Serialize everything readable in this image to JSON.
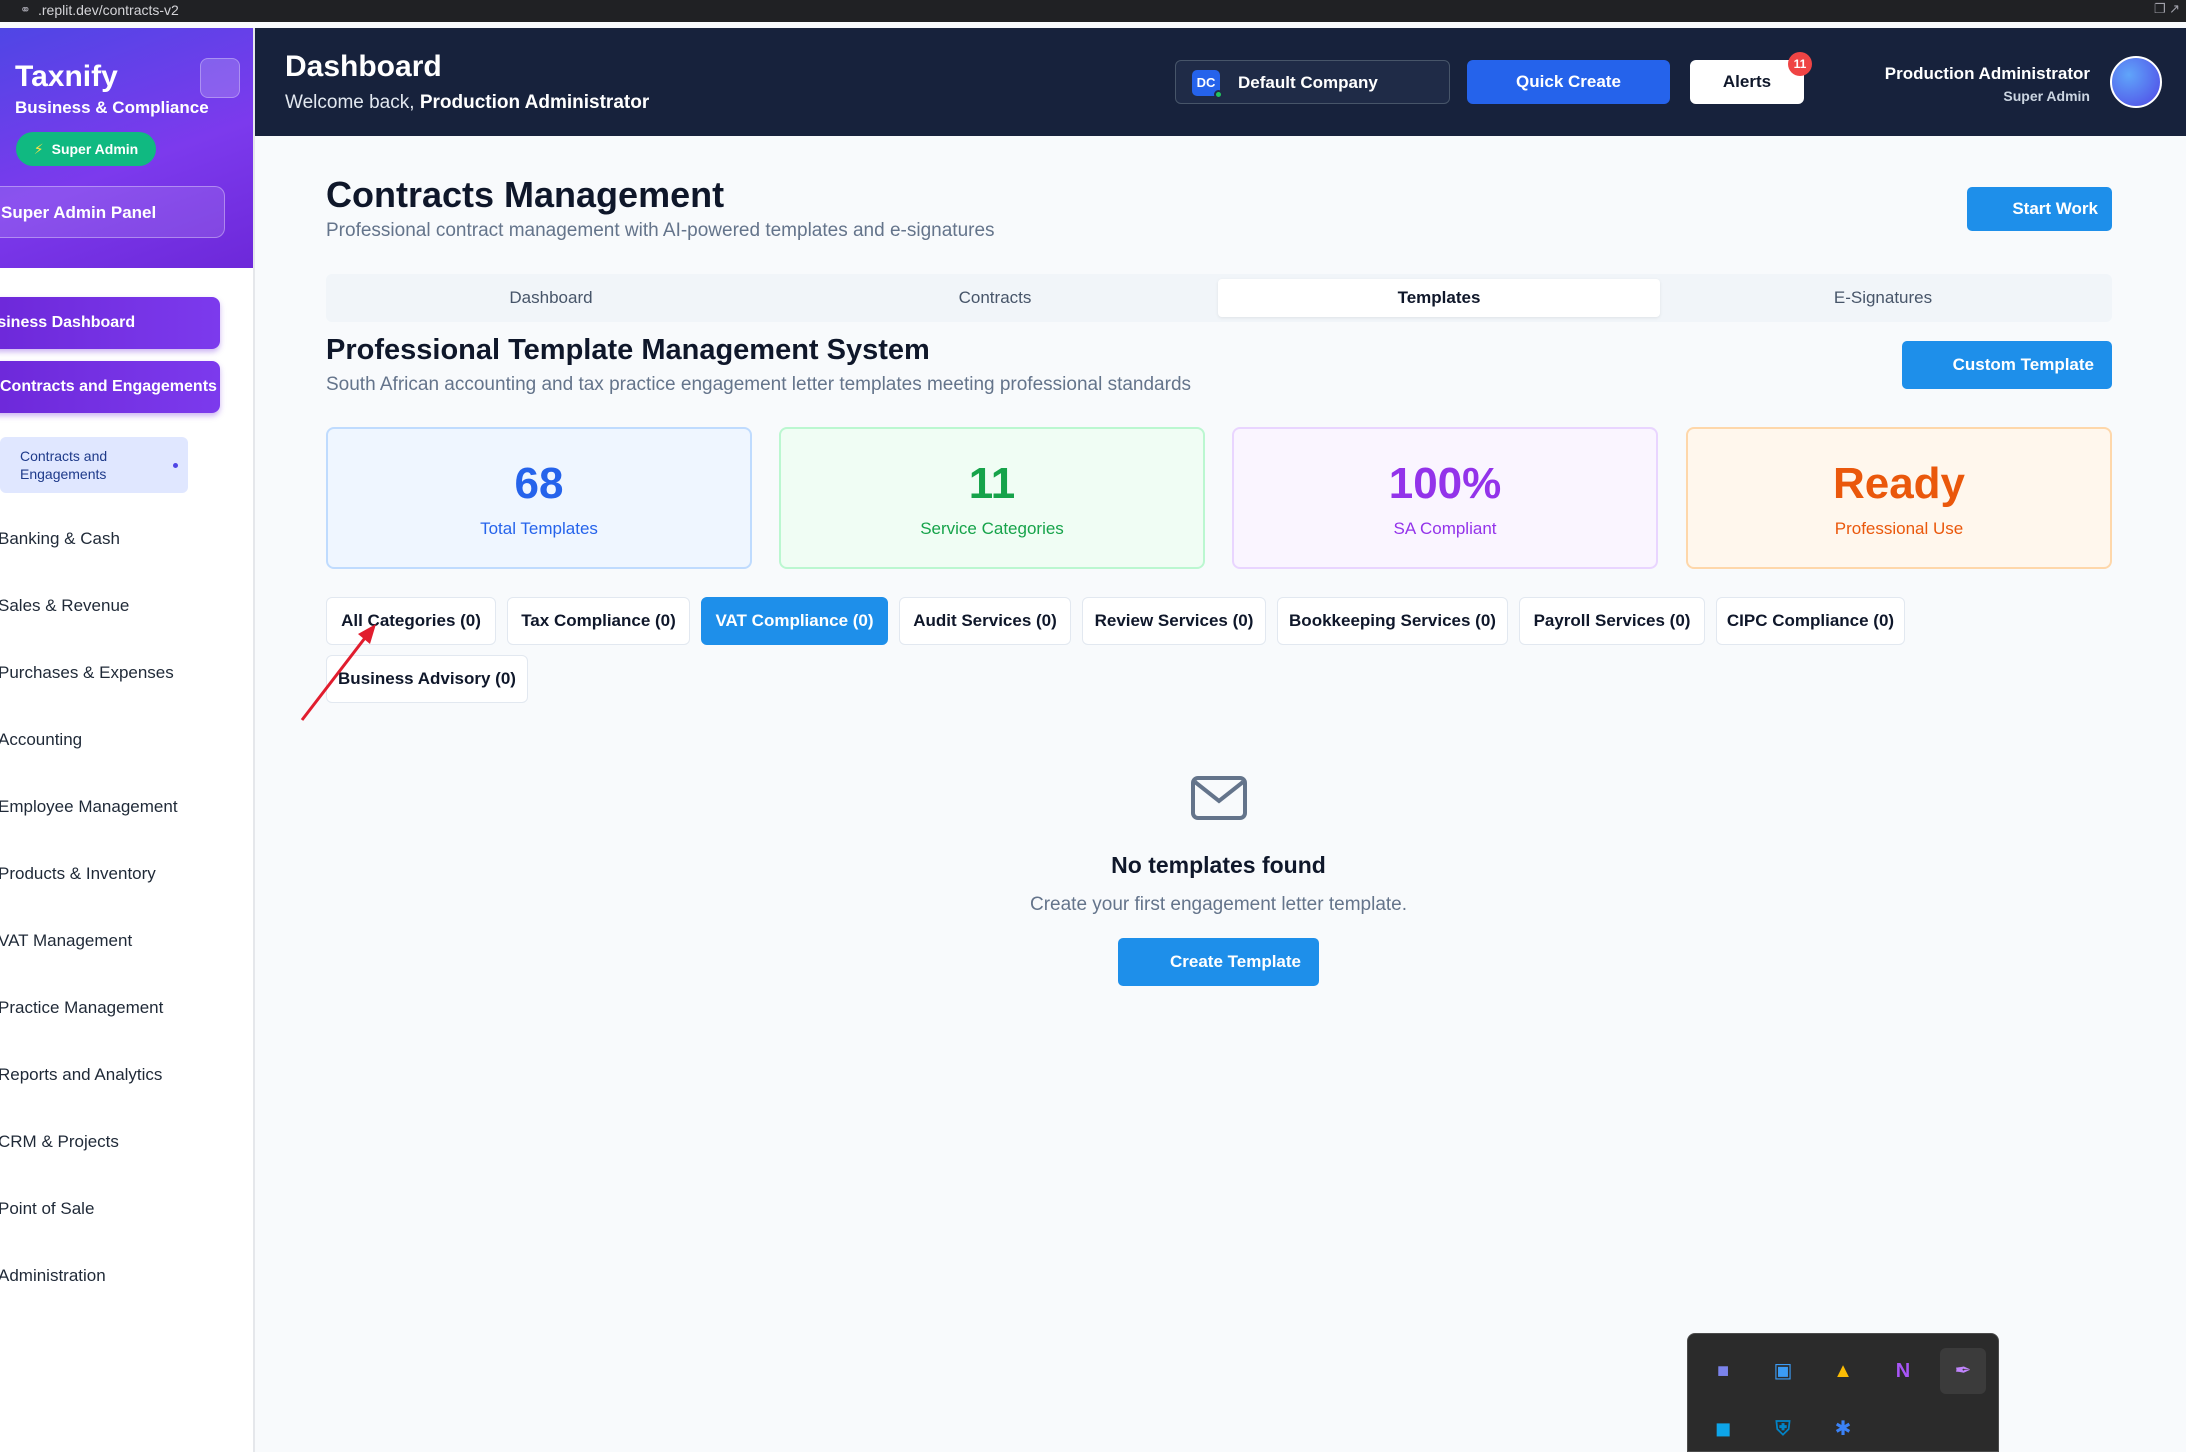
{
  "browser": {
    "url": ".replit.dev/contracts-v2"
  },
  "sidebar": {
    "brand": "Taxnify",
    "brand_sub": "Business & Compliance",
    "role_badge": "Super Admin",
    "panel_button": "Super Admin Panel",
    "active_items": [
      "Business Dashboard",
      "Contracts and Engagements"
    ],
    "sub_item": "Contracts and Engagements",
    "items": [
      "Banking & Cash",
      "Sales & Revenue",
      "Purchases & Expenses",
      "Accounting",
      "Employee Management",
      "Products & Inventory",
      "VAT Management",
      "Practice Management",
      "Reports and Analytics",
      "CRM & Projects",
      "Point of Sale",
      "Administration"
    ]
  },
  "header": {
    "title": "Dashboard",
    "welcome_prefix": "Welcome back,",
    "welcome_user": "Production Administrator",
    "company_abbr": "DC",
    "company": "Default Company",
    "quick_create": "Quick Create",
    "alerts": "Alerts",
    "alerts_count": "11",
    "user_name": "Production Administrator",
    "user_role": "Super Admin"
  },
  "main": {
    "title": "Contracts Management",
    "subtitle": "Professional contract management with AI-powered templates and e-signatures",
    "start_work": "Start Work",
    "tabs": [
      "Dashboard",
      "Contracts",
      "Templates",
      "E-Signatures"
    ],
    "active_tab": "Templates",
    "section_title": "Professional Template Management System",
    "section_subtitle": "South African accounting and tax practice engagement letter templates meeting professional standards",
    "custom_template": "Custom Template",
    "stats": [
      {
        "value": "68",
        "label": "Total Templates",
        "color": "#2563eb",
        "bg": "#eff6ff",
        "border": "#bfdbfe"
      },
      {
        "value": "11",
        "label": "Service Categories",
        "color": "#16a34a",
        "bg": "#f0fdf4",
        "border": "#bbf7d0"
      },
      {
        "value": "100%",
        "label": "SA Compliant",
        "color": "#9333ea",
        "bg": "#faf5ff",
        "border": "#e9d5ff"
      },
      {
        "value": "Ready",
        "label": "Professional Use",
        "color": "#ea580c",
        "bg": "#fff7ed",
        "border": "#fed7aa"
      }
    ],
    "filters": [
      "All Categories (0)",
      "Tax Compliance (0)",
      "VAT Compliance (0)",
      "Audit Services (0)",
      "Review Services (0)",
      "Bookkeeping Services (0)",
      "Payroll Services (0)",
      "CIPC Compliance (0)",
      "Business Advisory (0)"
    ],
    "active_filter": "VAT Compliance (0)",
    "empty_title": "No templates found",
    "empty_subtitle": "Create your first engagement letter template.",
    "create_template": "Create Template"
  },
  "tray": {
    "icons": [
      "teams-icon",
      "window-icon",
      "drive-icon",
      "onenote-icon",
      "pen-icon",
      "app-icon",
      "defender-icon",
      "bluetooth-icon"
    ],
    "onenote_letter": "N"
  },
  "colors": {
    "accent": "#1e8fea",
    "header_bg": "#17223c",
    "sidebar_gradient": "#7c3aed",
    "annotation_arrow": "#e11d2e"
  }
}
